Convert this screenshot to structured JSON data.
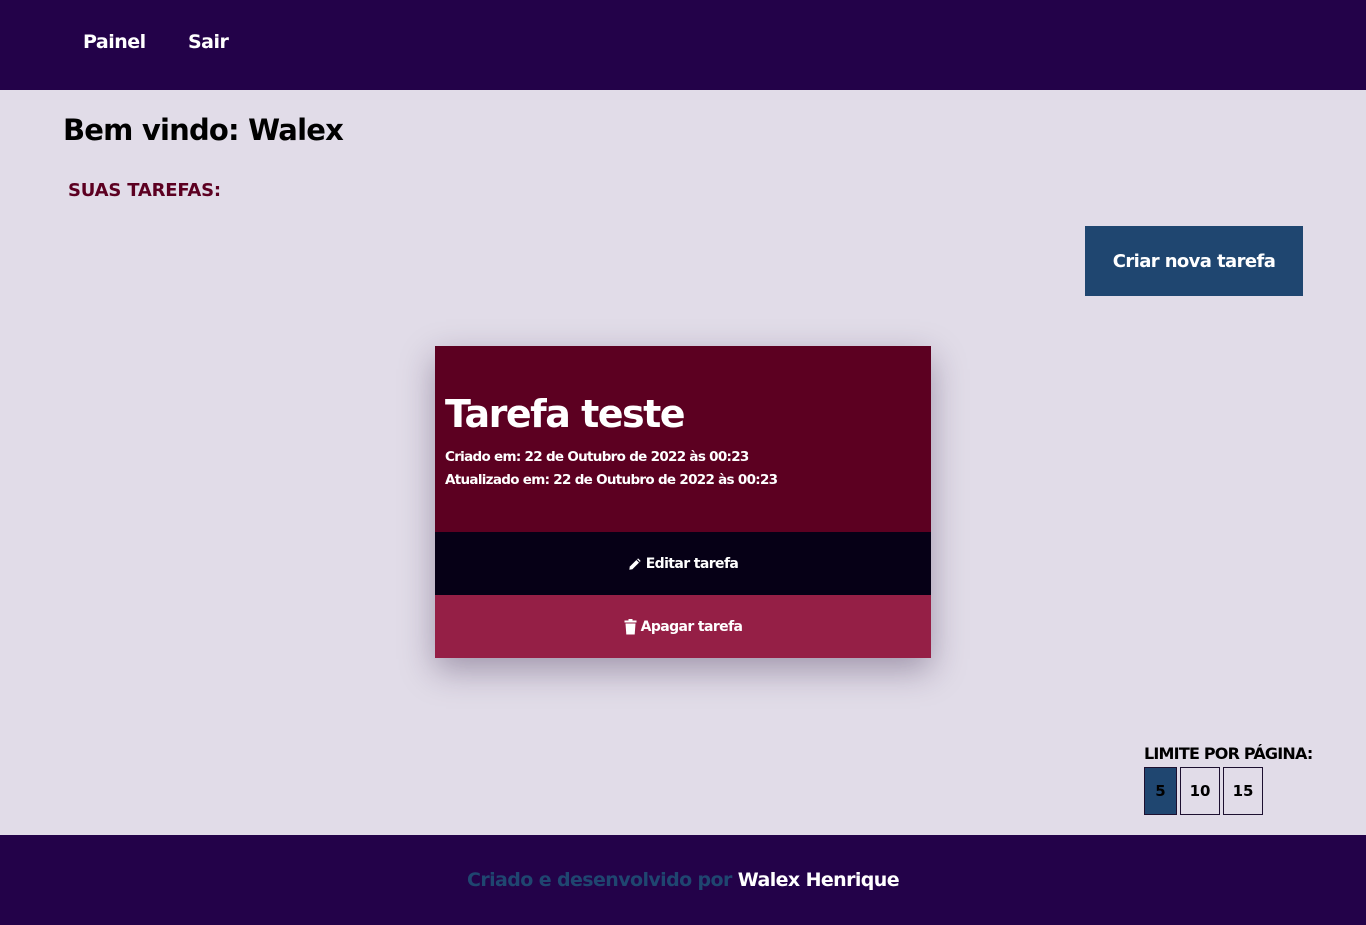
{
  "nav": {
    "items": [
      {
        "label": "Painel"
      },
      {
        "label": "Sair"
      }
    ]
  },
  "welcome": "Bem vindo: Walex",
  "section_title": "SUAS TAREFAS:",
  "create_button": "Criar nova tarefa",
  "task": {
    "title": "Tarefa teste",
    "created": "Criado em: 22 de Outubro de 2022 às 00:23",
    "updated": "Atualizado em: 22 de Outubro de 2022 às 00:23",
    "edit_label": "Editar tarefa",
    "edit_icon": "pencil-icon",
    "delete_label": "Apagar tarefa",
    "delete_icon": "trash-icon"
  },
  "pagination": {
    "label": "LIMITE POR PÁGINA:",
    "options": [
      "5",
      "10",
      "15"
    ],
    "selected": "5"
  },
  "footer": {
    "prefix": "Criado e desenvolvido por",
    "author": "Walex Henrique"
  },
  "colors": {
    "header_bg": "#230249",
    "page_bg": "#e1dce8",
    "accent_blue": "#1f4670",
    "card_header": "#5c0021",
    "edit_button": "#060016",
    "delete_button": "#951f46",
    "section_title": "#5c0021"
  }
}
